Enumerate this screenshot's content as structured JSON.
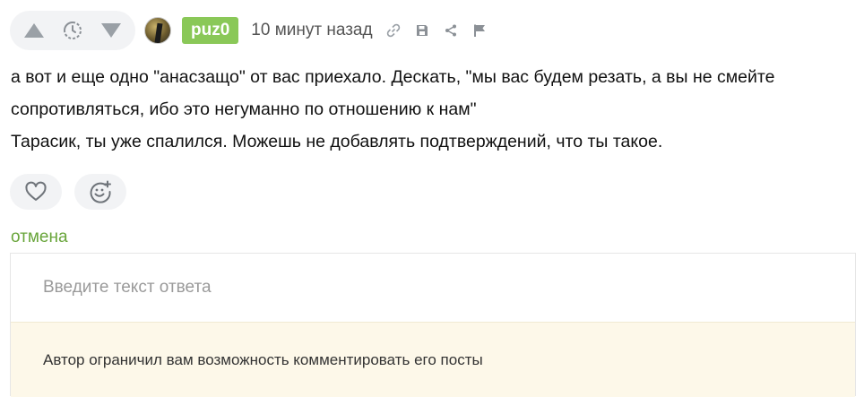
{
  "comment": {
    "author": "puz0",
    "time": "10 минут назад",
    "paragraphs": [
      "а вот и еще одно \"анасзащо\" от вас приехало. Дескать, \"мы вас будем резать, а вы не смейте сопротивляться, ибо это негуманно по отношению к нам\"",
      "Тарасик, ты уже спалился. Можешь не добавлять подтверждений, что ты такое."
    ]
  },
  "icons": {
    "upvote": "triangle-up-icon",
    "timer": "clock-icon",
    "downvote": "triangle-down-icon",
    "link": "link-icon",
    "save": "save-icon",
    "share": "share-icon",
    "report": "flag-icon",
    "like": "heart-icon",
    "react": "smiley-plus-icon"
  },
  "colors": {
    "author_badge": "#8ac858",
    "cancel_link": "#69a53b",
    "notice_bg": "#fdf8e9",
    "pill_bg": "#f2f3f5"
  },
  "reply": {
    "cancel_label": "отмена",
    "placeholder": "Введите текст ответа",
    "notice": "Автор ограничил вам возможность комментировать его посты"
  }
}
